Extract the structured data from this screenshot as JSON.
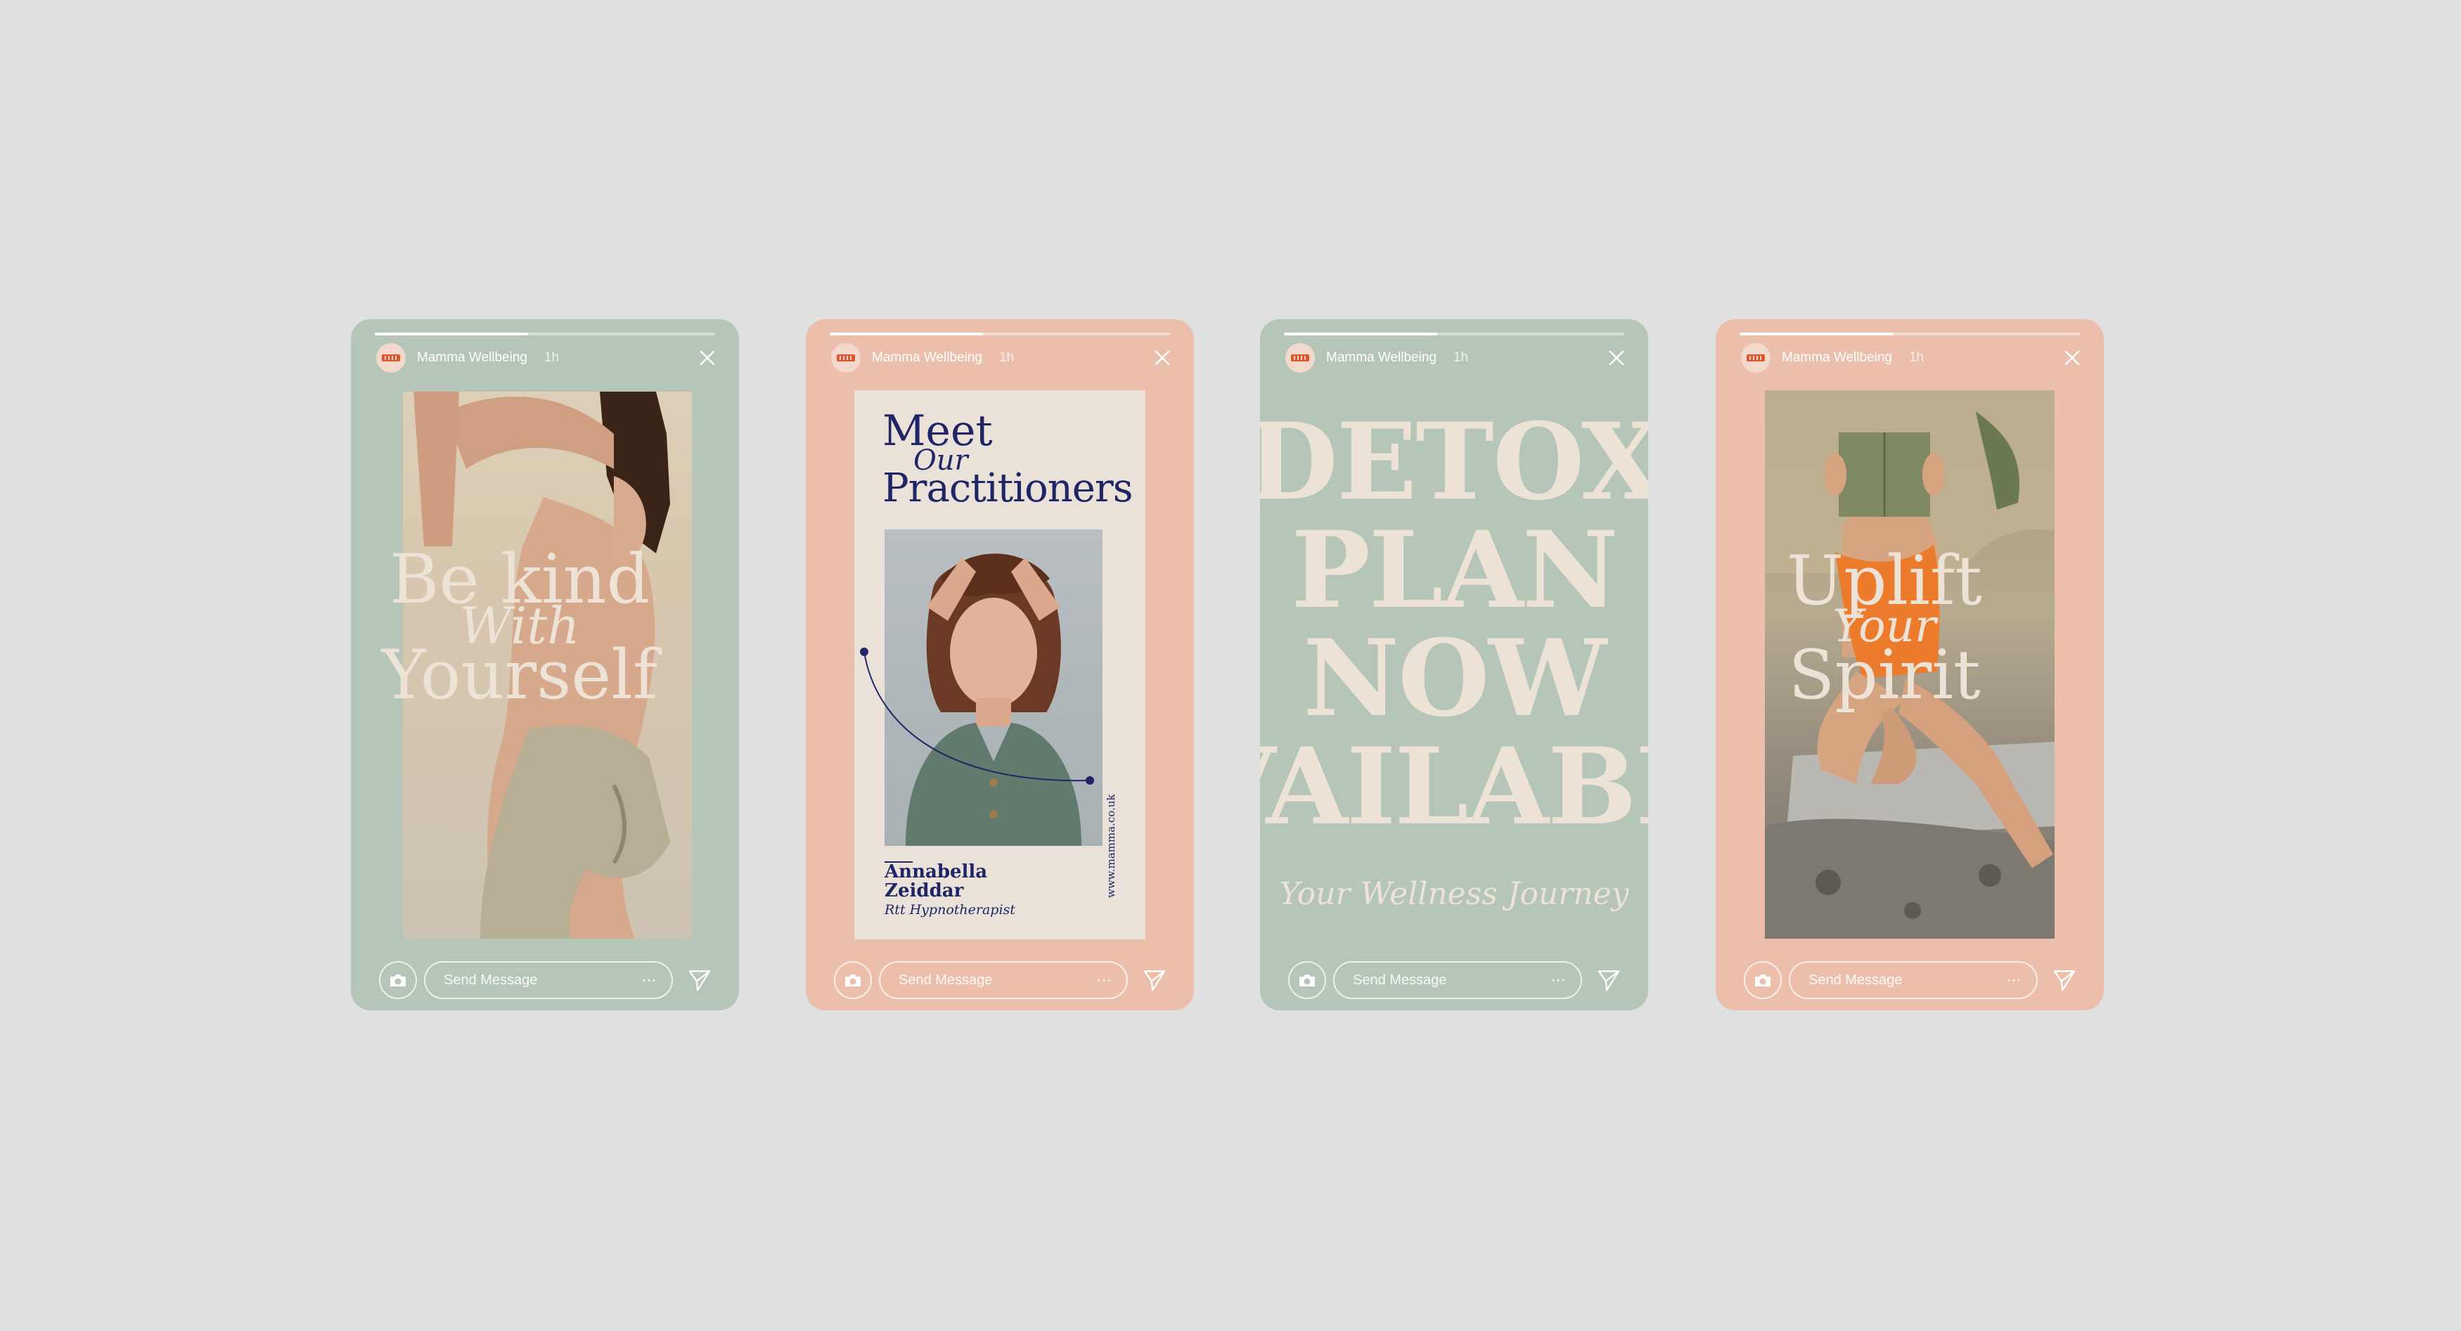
{
  "colors": {
    "background": "#e0e0e0",
    "sage": "#b5c5b8",
    "peach": "#ecbfad",
    "navy": "#1f2565",
    "cream": "#ede2d6"
  },
  "stories": [
    {
      "account": "Mamma Wellbeing",
      "time": "1h",
      "progress": 0.45,
      "headline": {
        "line1": "Be kind",
        "script": "With",
        "line2": "Yourself"
      },
      "message_placeholder": "Send Message"
    },
    {
      "account": "Mamma Wellbeing",
      "time": "1h",
      "progress": 0.45,
      "title": {
        "line1": "Meet",
        "script": "Our",
        "line2": "Practitioners"
      },
      "name": {
        "first": "Annabella",
        "last": "Zeiddar"
      },
      "role": "Rtt Hypnotherapist",
      "website": "www.mamma.co.uk",
      "message_placeholder": "Send Message"
    },
    {
      "account": "Mamma Wellbeing",
      "time": "1h",
      "progress": 0.45,
      "lines": [
        "DETOX",
        "PLAN",
        "NOW",
        "AVAILABLE"
      ],
      "tagline": "Your Wellness Journey",
      "message_placeholder": "Send Message"
    },
    {
      "account": "Mamma Wellbeing",
      "time": "1h",
      "progress": 0.45,
      "headline": {
        "line1": "Uplift",
        "script": "Your",
        "line2": "Spirit"
      },
      "message_placeholder": "Send Message"
    }
  ],
  "icons": [
    "camera-icon",
    "more-icon",
    "send-icon",
    "close-icon",
    "brand-logo-icon"
  ]
}
